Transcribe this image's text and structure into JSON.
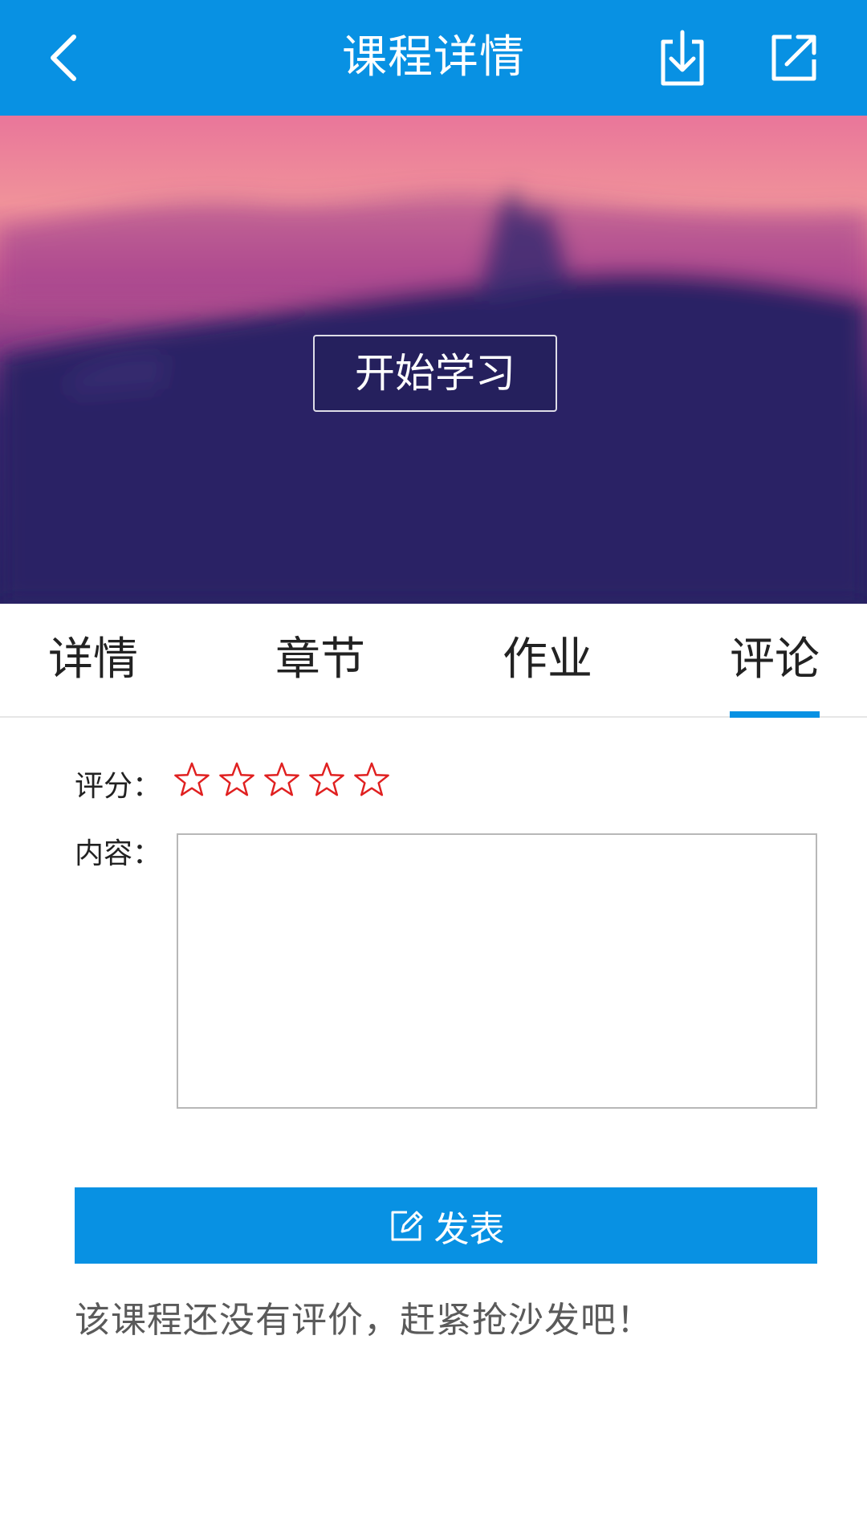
{
  "header": {
    "title": "课程详情",
    "back_icon": "chevron-left-icon",
    "download_icon": "download-icon",
    "share_icon": "share-external-icon",
    "background": "#0891e3"
  },
  "hero": {
    "start_button_label": "开始学习"
  },
  "tabs": [
    {
      "label": "详情",
      "active": false
    },
    {
      "label": "章节",
      "active": false
    },
    {
      "label": "作业",
      "active": false
    },
    {
      "label": "评论",
      "active": true
    }
  ],
  "review": {
    "rating_label": "评分：",
    "rating_value": 0,
    "rating_max": 5,
    "star_color": "#e02020",
    "content_label": "内容：",
    "content_value": "",
    "publish_label": "发表",
    "publish_icon": "edit-icon",
    "empty_message": "该课程还没有评价，赶紧抢沙发吧！"
  }
}
